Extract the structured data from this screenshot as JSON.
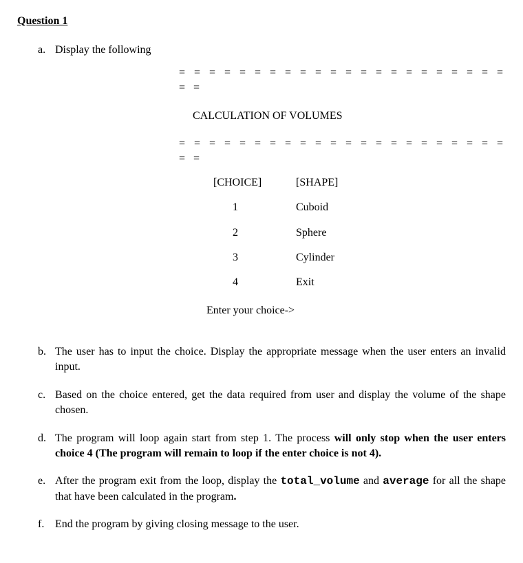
{
  "heading": "Question 1",
  "items": {
    "a": {
      "marker": "a.",
      "text": "Display the following",
      "display": {
        "divider": "= = = = = = = = = = = = = = = = = = = = = = = =",
        "title": "CALCULATION OF VOLUMES",
        "headers": {
          "choice": "[CHOICE]",
          "shape": "[SHAPE]"
        },
        "rows": [
          {
            "num": "1",
            "shape": "Cuboid"
          },
          {
            "num": "2",
            "shape": "Sphere"
          },
          {
            "num": "3",
            "shape": "Cylinder"
          },
          {
            "num": "4",
            "shape": "Exit"
          }
        ],
        "prompt": "Enter your choice->"
      }
    },
    "b": {
      "marker": "b.",
      "text": "The user has to input the choice. Display the appropriate message when the user enters an invalid input."
    },
    "c": {
      "marker": "c.",
      "text": "Based on the choice entered, get the data required from user and display the volume of the shape chosen."
    },
    "d": {
      "marker": "d.",
      "pre": "The program will loop again start from step 1. The process ",
      "bold": "will only stop when the user enters choice 4 (The program will remain to loop if the enter choice is not 4)."
    },
    "e": {
      "marker": "e.",
      "t1": "After the program exit from the loop, display the ",
      "code1": "total_volume",
      "t2": " and ",
      "code2": "average",
      "t3": " for all the shape that have been calculated in the program",
      "period": "."
    },
    "f": {
      "marker": "f.",
      "text": "End the program by giving closing message to the user."
    }
  }
}
